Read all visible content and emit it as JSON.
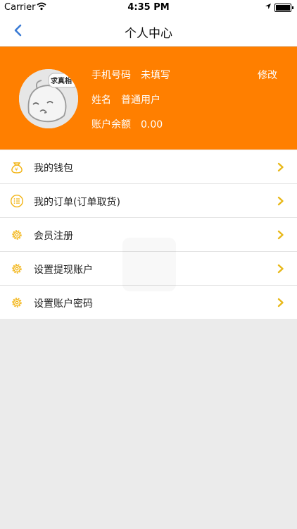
{
  "status_bar": {
    "carrier": "Carrier",
    "time": "4:35 PM"
  },
  "nav": {
    "title": "个人中心"
  },
  "profile": {
    "avatar_text": "求真相",
    "phone_label": "手机号码",
    "phone_value": "未填写",
    "name_label": "姓名",
    "name_value": "普通用户",
    "balance_label": "账户余额",
    "balance_value": "0.00",
    "edit_label": "修改"
  },
  "menu": [
    {
      "label": "我的钱包",
      "icon": "wallet-icon"
    },
    {
      "label": "我的订单(订单取货)",
      "icon": "order-list-icon"
    },
    {
      "label": "会员注册",
      "icon": "gear-icon"
    },
    {
      "label": "设置提现账户",
      "icon": "gear-icon"
    },
    {
      "label": "设置账户密码",
      "icon": "gear-icon"
    }
  ],
  "colors": {
    "accent": "#ff7f00",
    "icon": "#f2b311",
    "chevron": "#e8b819",
    "back": "#3a7bd5"
  }
}
